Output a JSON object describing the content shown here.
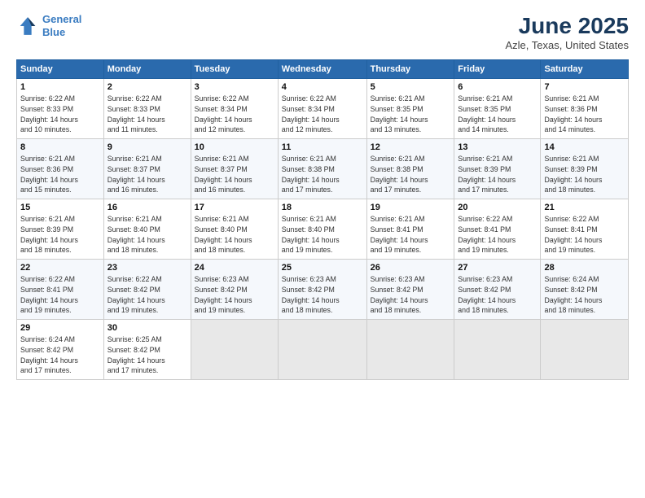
{
  "header": {
    "logo_line1": "General",
    "logo_line2": "Blue",
    "month": "June 2025",
    "location": "Azle, Texas, United States"
  },
  "weekdays": [
    "Sunday",
    "Monday",
    "Tuesday",
    "Wednesday",
    "Thursday",
    "Friday",
    "Saturday"
  ],
  "weeks": [
    [
      {
        "day": 1,
        "info": "Sunrise: 6:22 AM\nSunset: 8:33 PM\nDaylight: 14 hours\nand 10 minutes."
      },
      {
        "day": 2,
        "info": "Sunrise: 6:22 AM\nSunset: 8:33 PM\nDaylight: 14 hours\nand 11 minutes."
      },
      {
        "day": 3,
        "info": "Sunrise: 6:22 AM\nSunset: 8:34 PM\nDaylight: 14 hours\nand 12 minutes."
      },
      {
        "day": 4,
        "info": "Sunrise: 6:22 AM\nSunset: 8:34 PM\nDaylight: 14 hours\nand 12 minutes."
      },
      {
        "day": 5,
        "info": "Sunrise: 6:21 AM\nSunset: 8:35 PM\nDaylight: 14 hours\nand 13 minutes."
      },
      {
        "day": 6,
        "info": "Sunrise: 6:21 AM\nSunset: 8:35 PM\nDaylight: 14 hours\nand 14 minutes."
      },
      {
        "day": 7,
        "info": "Sunrise: 6:21 AM\nSunset: 8:36 PM\nDaylight: 14 hours\nand 14 minutes."
      }
    ],
    [
      {
        "day": 8,
        "info": "Sunrise: 6:21 AM\nSunset: 8:36 PM\nDaylight: 14 hours\nand 15 minutes."
      },
      {
        "day": 9,
        "info": "Sunrise: 6:21 AM\nSunset: 8:37 PM\nDaylight: 14 hours\nand 16 minutes."
      },
      {
        "day": 10,
        "info": "Sunrise: 6:21 AM\nSunset: 8:37 PM\nDaylight: 14 hours\nand 16 minutes."
      },
      {
        "day": 11,
        "info": "Sunrise: 6:21 AM\nSunset: 8:38 PM\nDaylight: 14 hours\nand 17 minutes."
      },
      {
        "day": 12,
        "info": "Sunrise: 6:21 AM\nSunset: 8:38 PM\nDaylight: 14 hours\nand 17 minutes."
      },
      {
        "day": 13,
        "info": "Sunrise: 6:21 AM\nSunset: 8:39 PM\nDaylight: 14 hours\nand 17 minutes."
      },
      {
        "day": 14,
        "info": "Sunrise: 6:21 AM\nSunset: 8:39 PM\nDaylight: 14 hours\nand 18 minutes."
      }
    ],
    [
      {
        "day": 15,
        "info": "Sunrise: 6:21 AM\nSunset: 8:39 PM\nDaylight: 14 hours\nand 18 minutes."
      },
      {
        "day": 16,
        "info": "Sunrise: 6:21 AM\nSunset: 8:40 PM\nDaylight: 14 hours\nand 18 minutes."
      },
      {
        "day": 17,
        "info": "Sunrise: 6:21 AM\nSunset: 8:40 PM\nDaylight: 14 hours\nand 18 minutes."
      },
      {
        "day": 18,
        "info": "Sunrise: 6:21 AM\nSunset: 8:40 PM\nDaylight: 14 hours\nand 19 minutes."
      },
      {
        "day": 19,
        "info": "Sunrise: 6:21 AM\nSunset: 8:41 PM\nDaylight: 14 hours\nand 19 minutes."
      },
      {
        "day": 20,
        "info": "Sunrise: 6:22 AM\nSunset: 8:41 PM\nDaylight: 14 hours\nand 19 minutes."
      },
      {
        "day": 21,
        "info": "Sunrise: 6:22 AM\nSunset: 8:41 PM\nDaylight: 14 hours\nand 19 minutes."
      }
    ],
    [
      {
        "day": 22,
        "info": "Sunrise: 6:22 AM\nSunset: 8:41 PM\nDaylight: 14 hours\nand 19 minutes."
      },
      {
        "day": 23,
        "info": "Sunrise: 6:22 AM\nSunset: 8:42 PM\nDaylight: 14 hours\nand 19 minutes."
      },
      {
        "day": 24,
        "info": "Sunrise: 6:23 AM\nSunset: 8:42 PM\nDaylight: 14 hours\nand 19 minutes."
      },
      {
        "day": 25,
        "info": "Sunrise: 6:23 AM\nSunset: 8:42 PM\nDaylight: 14 hours\nand 18 minutes."
      },
      {
        "day": 26,
        "info": "Sunrise: 6:23 AM\nSunset: 8:42 PM\nDaylight: 14 hours\nand 18 minutes."
      },
      {
        "day": 27,
        "info": "Sunrise: 6:23 AM\nSunset: 8:42 PM\nDaylight: 14 hours\nand 18 minutes."
      },
      {
        "day": 28,
        "info": "Sunrise: 6:24 AM\nSunset: 8:42 PM\nDaylight: 14 hours\nand 18 minutes."
      }
    ],
    [
      {
        "day": 29,
        "info": "Sunrise: 6:24 AM\nSunset: 8:42 PM\nDaylight: 14 hours\nand 17 minutes."
      },
      {
        "day": 30,
        "info": "Sunrise: 6:25 AM\nSunset: 8:42 PM\nDaylight: 14 hours\nand 17 minutes."
      },
      null,
      null,
      null,
      null,
      null
    ]
  ]
}
